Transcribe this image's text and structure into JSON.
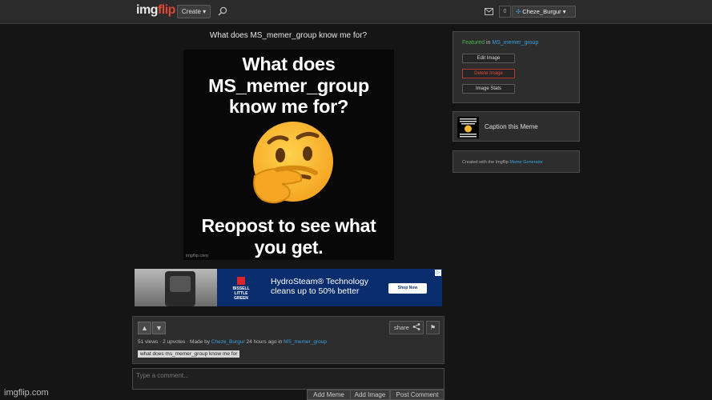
{
  "header": {
    "logo_part1": "img",
    "logo_part2": "flip",
    "create_label": "Create ▾",
    "notification_count": "0",
    "username": "Cheze_Burgur"
  },
  "meme": {
    "title": "What does MS_memer_group know me for?",
    "top_text": "What does MS_memer_group know me for?",
    "bottom_text": "Reopost to see what you get.",
    "watermark": "imgflip.com"
  },
  "ad": {
    "brand": "BISSELL",
    "sub_brand": "LITTLE GREEN",
    "headline_line1": "HydroSteam® Technology",
    "headline_line2": "cleans up to 50% better",
    "cta": "Shop Now"
  },
  "vote_panel": {
    "upvote_icon": "▲",
    "downvote_icon": "▼",
    "share_label": "share",
    "flag_icon": "⚑",
    "stats_prefix": "51 views · 2 upvotes · Made by ",
    "author": "Cheze_Burgur",
    "stats_middle": " 24 hours ago in ",
    "stream": "MS_memer_group",
    "tag": "what does ms_memer_group know me for"
  },
  "comment": {
    "placeholder": "Type a comment...",
    "add_meme": "Add Meme",
    "add_image": "Add Image",
    "post_comment": "Post Comment"
  },
  "sidebar": {
    "featured_label": "Featured",
    "featured_in": " in ",
    "featured_stream": "MS_memer_group",
    "edit_image": "Edit Image",
    "delete_image": "Delete Image",
    "image_stats": "Image Stats",
    "caption_meme": "Caption this Meme",
    "created_with": "Created with the Imgflip ",
    "meme_generator": "Meme Generator"
  },
  "footer": {
    "watermark": "imgflip.com"
  },
  "colors": {
    "accent_link": "#3aa0e0",
    "brand_red": "#e04836",
    "featured_green": "#4caf50"
  }
}
